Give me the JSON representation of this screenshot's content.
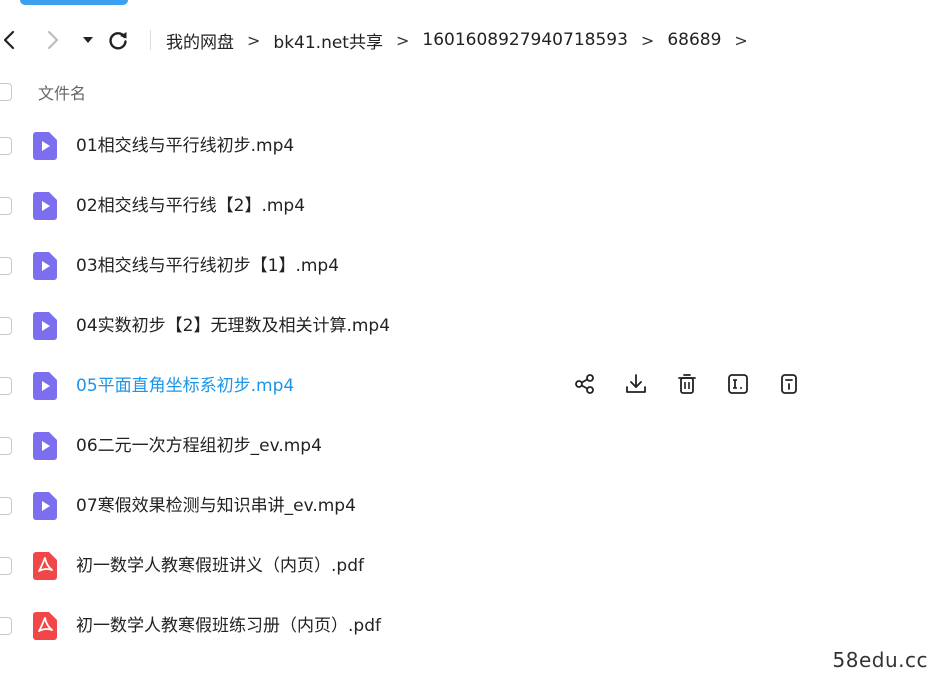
{
  "breadcrumb": {
    "items": [
      "我的网盘",
      "bk41.net共享",
      "1601608927940718593",
      "68689"
    ],
    "separator": ">"
  },
  "header": {
    "filename_label": "文件名"
  },
  "files": [
    {
      "name": "01相交线与平行线初步.mp4",
      "type": "video-file-icon"
    },
    {
      "name": "02相交线与平行线【2】.mp4",
      "type": "video-file-icon"
    },
    {
      "name": "03相交线与平行线初步【1】.mp4",
      "type": "video-file-icon"
    },
    {
      "name": "04实数初步【2】无理数及相关计算.mp4",
      "type": "video-file-icon"
    },
    {
      "name": "05平面直角坐标系初步.mp4",
      "type": "video-file-icon",
      "active": true
    },
    {
      "name": "06二元一次方程组初步_ev.mp4",
      "type": "video-file-icon"
    },
    {
      "name": "07寒假效果检测与知识串讲_ev.mp4",
      "type": "video-file-icon"
    },
    {
      "name": "初一数学人教寒假班讲义（内页）.pdf",
      "type": "pdf-file-icon"
    },
    {
      "name": "初一数学人教寒假班练习册（内页）.pdf",
      "type": "pdf-file-icon"
    }
  ],
  "row_actions": [
    "share-icon",
    "download-icon",
    "delete-icon",
    "rename-icon",
    "more-info-icon"
  ],
  "watermark": "58edu.cc",
  "colors": {
    "accent": "#1c95e8",
    "video_icon": "#7b6ff0",
    "pdf_icon": "#f04848"
  }
}
